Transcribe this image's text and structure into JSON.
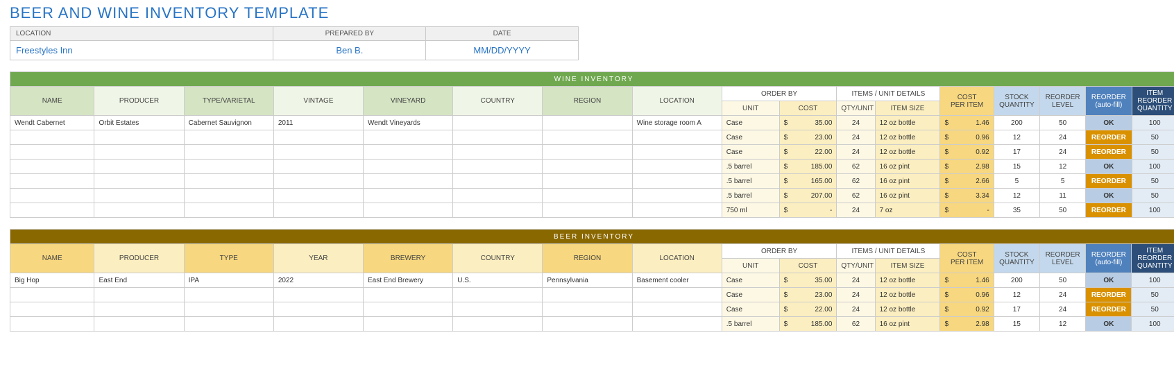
{
  "title": "BEER AND WINE INVENTORY TEMPLATE",
  "info_headers": {
    "location": "LOCATION",
    "prepared_by": "PREPARED BY",
    "date": "DATE"
  },
  "info": {
    "location": "Freestyles Inn",
    "prepared_by": "Ben B.",
    "date": "MM/DD/YYYY"
  },
  "sections": {
    "wine": {
      "banner": "WINE INVENTORY",
      "headers": {
        "name": "NAME",
        "producer": "PRODUCER",
        "type": "TYPE/VARIETAL",
        "vintage": "VINTAGE",
        "vineyard": "VINEYARD",
        "country": "COUNTRY",
        "region": "REGION",
        "location": "LOCATION",
        "order_by": "ORDER BY",
        "unit": "UNIT",
        "cost": "COST",
        "items_unit_details": "ITEMS / UNIT DETAILS",
        "qty_unit": "QTY/UNIT",
        "item_size": "ITEM SIZE",
        "cost_per_item": "COST\nPER ITEM",
        "stock_quantity": "STOCK\nQUANTITY",
        "reorder_level": "REORDER\nLEVEL",
        "reorder_auto": "REORDER\n(auto-fill)",
        "item_reorder_quantity": "ITEM\nREORDER\nQUANTITY"
      },
      "rows": [
        {
          "name": "Wendt Cabernet",
          "producer": "Orbit Estates",
          "type": "Cabernet Sauvignon",
          "vintage": "2011",
          "vineyard": "Wendt Vineyards",
          "country": "",
          "region": "",
          "location": "Wine storage room A",
          "unit": "Case",
          "cost": "35.00",
          "qty": "24",
          "size": "12 oz bottle",
          "cpi": "1.46",
          "stock": "200",
          "rl": "50",
          "status": "OK",
          "irq": "100"
        },
        {
          "unit": "Case",
          "cost": "23.00",
          "qty": "24",
          "size": "12 oz bottle",
          "cpi": "0.96",
          "stock": "12",
          "rl": "24",
          "status": "REORDER",
          "irq": "50"
        },
        {
          "unit": "Case",
          "cost": "22.00",
          "qty": "24",
          "size": "12 oz bottle",
          "cpi": "0.92",
          "stock": "17",
          "rl": "24",
          "status": "REORDER",
          "irq": "50"
        },
        {
          "unit": ".5 barrel",
          "cost": "185.00",
          "qty": "62",
          "size": "16 oz pint",
          "cpi": "2.98",
          "stock": "15",
          "rl": "12",
          "status": "OK",
          "irq": "100"
        },
        {
          "unit": ".5 barrel",
          "cost": "165.00",
          "qty": "62",
          "size": "16 oz pint",
          "cpi": "2.66",
          "stock": "5",
          "rl": "5",
          "status": "REORDER",
          "irq": "50"
        },
        {
          "unit": ".5 barrel",
          "cost": "207.00",
          "qty": "62",
          "size": "16 oz pint",
          "cpi": "3.34",
          "stock": "12",
          "rl": "11",
          "status": "OK",
          "irq": "50"
        },
        {
          "unit": "750 ml",
          "cost": "-",
          "qty": "24",
          "size": "7 oz",
          "cpi": "-",
          "stock": "35",
          "rl": "50",
          "status": "REORDER",
          "irq": "100"
        }
      ]
    },
    "beer": {
      "banner": "BEER INVENTORY",
      "headers": {
        "name": "NAME",
        "producer": "PRODUCER",
        "type": "TYPE",
        "year": "YEAR",
        "brewery": "BREWERY",
        "country": "COUNTRY",
        "region": "REGION",
        "location": "LOCATION",
        "order_by": "ORDER BY",
        "unit": "UNIT",
        "cost": "COST",
        "items_unit_details": "ITEMS / UNIT DETAILS",
        "qty_unit": "QTY/UNIT",
        "item_size": "ITEM SIZE",
        "cost_per_item": "COST\nPER ITEM",
        "stock_quantity": "STOCK\nQUANTITY",
        "reorder_level": "REORDER\nLEVEL",
        "reorder_auto": "REORDER\n(auto-fill)",
        "item_reorder_quantity": "ITEM\nREORDER\nQUANTITY"
      },
      "rows": [
        {
          "name": "Big Hop",
          "producer": "East End",
          "type": "IPA",
          "year": "2022",
          "brewery": "East End Brewery",
          "country": "U.S.",
          "region": "Pennsylvania",
          "location": "Basement cooler",
          "unit": "Case",
          "cost": "35.00",
          "qty": "24",
          "size": "12 oz bottle",
          "cpi": "1.46",
          "stock": "200",
          "rl": "50",
          "status": "OK",
          "irq": "100"
        },
        {
          "unit": "Case",
          "cost": "23.00",
          "qty": "24",
          "size": "12 oz bottle",
          "cpi": "0.96",
          "stock": "12",
          "rl": "24",
          "status": "REORDER",
          "irq": "50"
        },
        {
          "unit": "Case",
          "cost": "22.00",
          "qty": "24",
          "size": "12 oz bottle",
          "cpi": "0.92",
          "stock": "17",
          "rl": "24",
          "status": "REORDER",
          "irq": "50"
        },
        {
          "unit": ".5 barrel",
          "cost": "185.00",
          "qty": "62",
          "size": "16 oz pint",
          "cpi": "2.98",
          "stock": "15",
          "rl": "12",
          "status": "OK",
          "irq": "100"
        }
      ]
    }
  }
}
